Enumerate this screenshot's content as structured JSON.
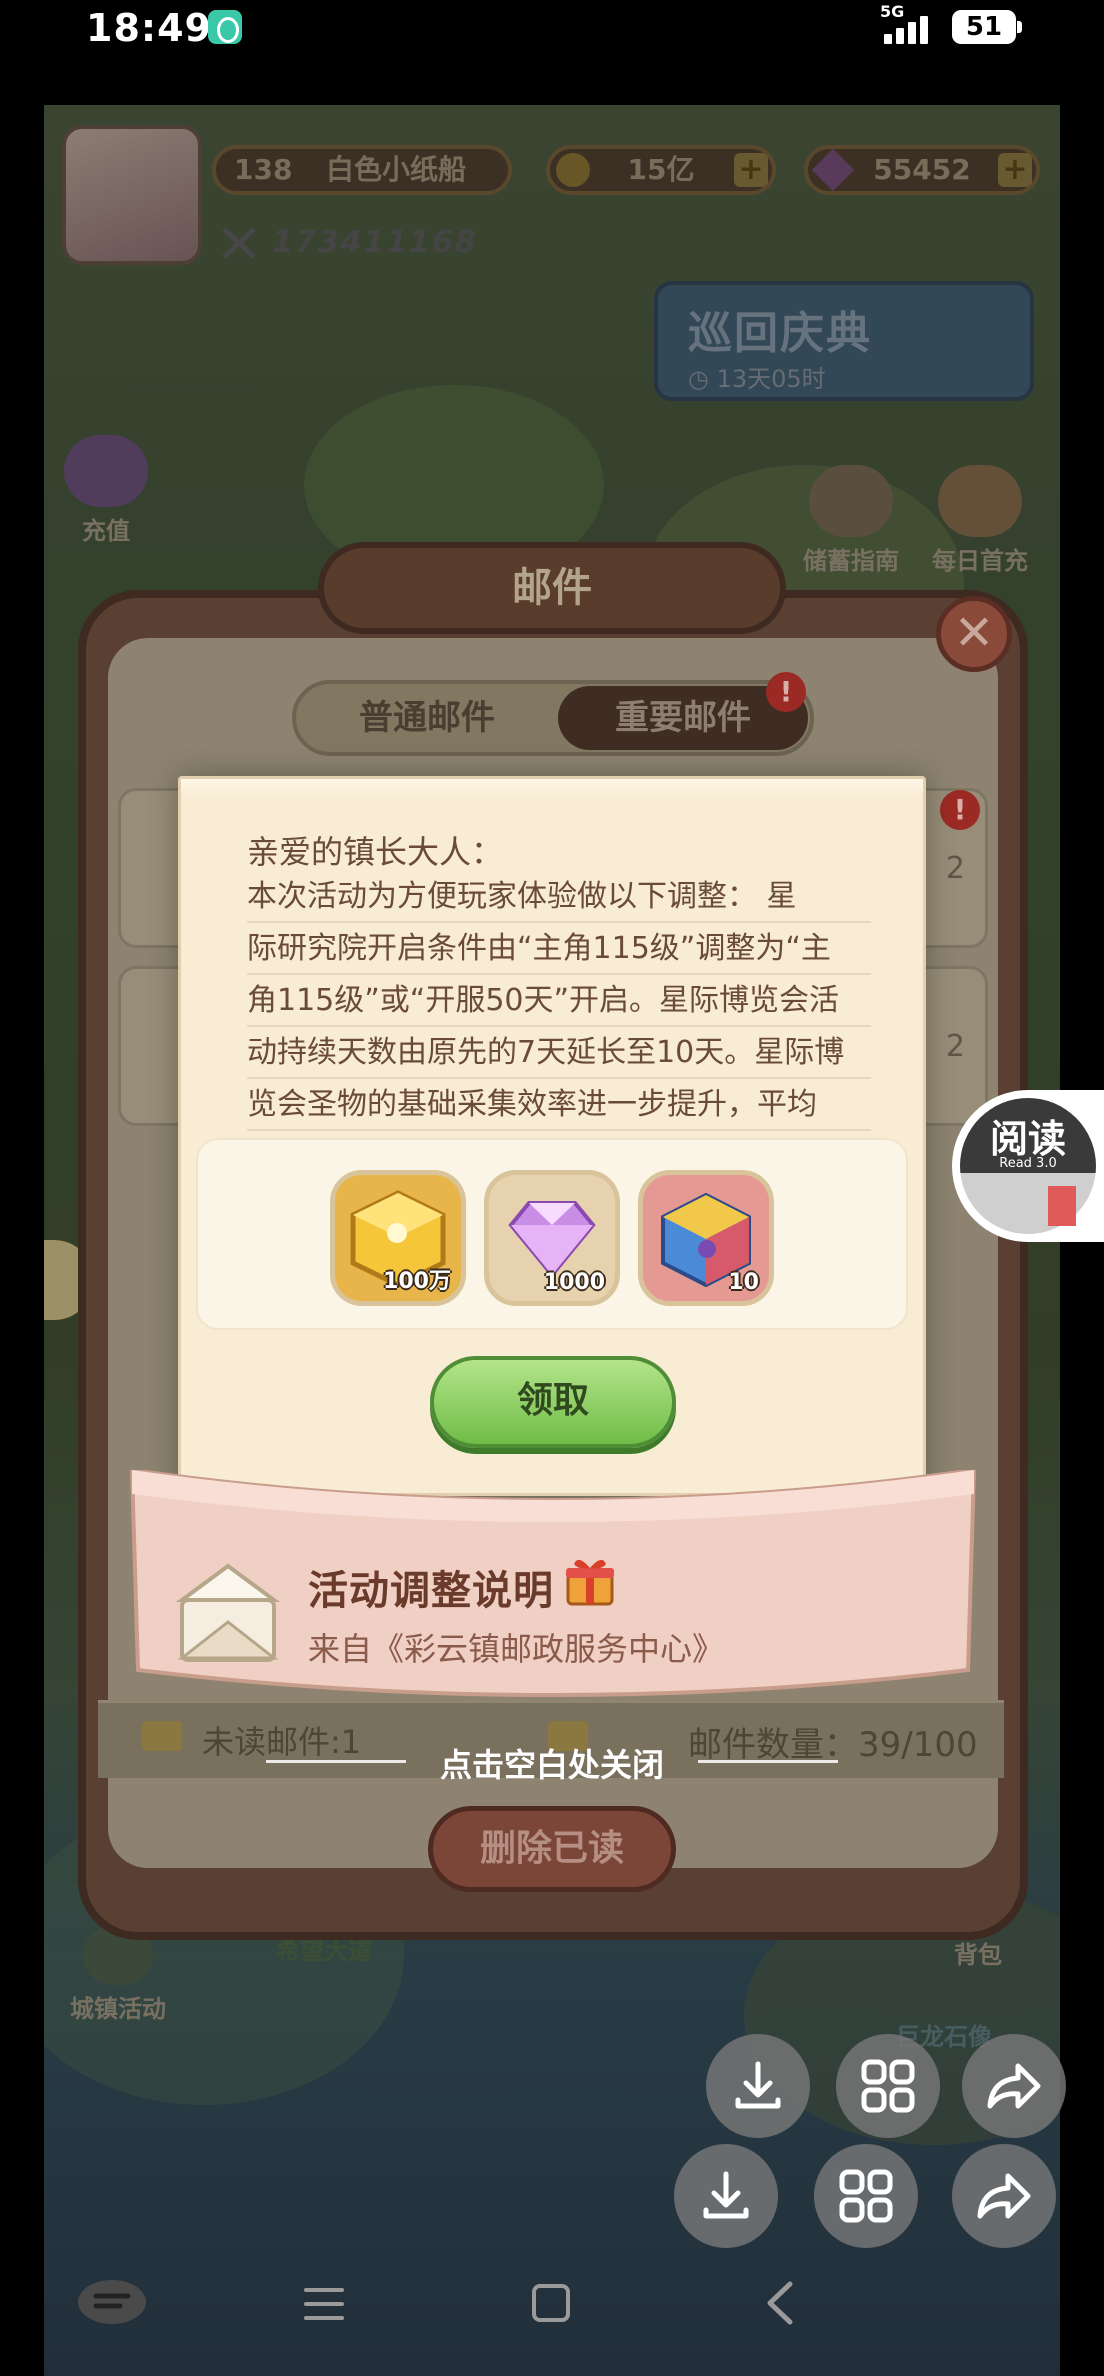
{
  "status_bar": {
    "time": "18:49",
    "network": "5G",
    "battery": "51"
  },
  "player": {
    "level": "138",
    "name": "白色小纸船",
    "uid": "173411168",
    "gold": "15亿",
    "gems": "55452"
  },
  "event": {
    "title": "巡回庆典",
    "time_left": "13天05时"
  },
  "side_buttons": {
    "recharge": "充值",
    "savings_guide": "储蓄指南",
    "daily_first_recharge": "每日首充"
  },
  "mail_window": {
    "title": "邮件",
    "tabs": [
      {
        "label": "普通邮件"
      },
      {
        "label": "重要邮件"
      }
    ],
    "badge": "!",
    "list_numbers": [
      "2",
      "2"
    ],
    "unread": "未读邮件:1",
    "count": "邮件数量：39/100",
    "delete_read": "删除已读"
  },
  "letter": {
    "salutation": "亲爱的镇长大人：",
    "lines": [
      "本次活动为方便玩家体验做以下调整：  星",
      "际研究院开启条件由“主角115级”调整为“主",
      "角115级”或“开服50天”开启。星际博览会活",
      "动持续天数由原先的7天延长至10天。星际博",
      "览会圣物的基础采集效率进一步提升，平均"
    ],
    "rewards": [
      {
        "icon": "gold-cube-icon",
        "quantity": "100万"
      },
      {
        "icon": "diamond-icon",
        "quantity": "1000"
      },
      {
        "icon": "rainbow-cube-icon",
        "quantity": "10"
      }
    ],
    "claim": "领取",
    "subject": "活动调整说明",
    "sender": "来自《彩云镇邮政服务中心》"
  },
  "close_hint": "点击空白处关闭",
  "bottom_menu": {
    "town_activity": "城镇活动",
    "backpack": "背包",
    "dragon_statue": "巨龙石像",
    "hope_plaza": "希望大道"
  },
  "read_widget": {
    "label": "阅读",
    "sub": "Read 3.0"
  }
}
